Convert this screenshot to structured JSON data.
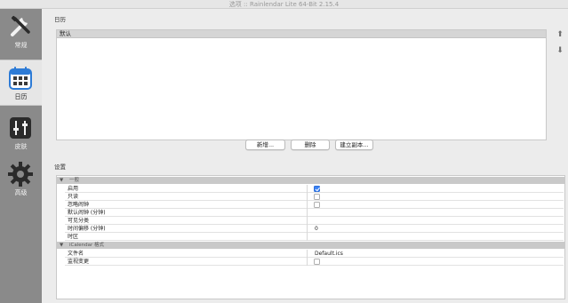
{
  "window": {
    "title": "选项 :: Rainlendar Lite 64-Bit 2.15.4"
  },
  "sidebar": {
    "items": [
      {
        "label": "常规",
        "icon": "tools-icon",
        "active": false
      },
      {
        "label": "日历",
        "icon": "calendar-icon",
        "active": true
      },
      {
        "label": "皮肤",
        "icon": "sliders-icon",
        "active": false
      },
      {
        "label": "高级",
        "icon": "gear-icon",
        "active": false
      }
    ]
  },
  "calendars": {
    "section_label": "日历",
    "list_header": "默认",
    "move_up_icon": "arrow-up-icon",
    "move_down_icon": "arrow-down-icon",
    "buttons": {
      "new": "新增...",
      "delete": "删除",
      "duplicate": "建立副本..."
    }
  },
  "settings": {
    "section_label": "设置",
    "groups": [
      {
        "label": "一般",
        "rows": [
          {
            "name": "启用",
            "type": "checkbox",
            "checked": true
          },
          {
            "name": "只读",
            "type": "checkbox",
            "checked": false
          },
          {
            "name": "忽略闹钟",
            "type": "checkbox",
            "checked": false
          },
          {
            "name": "默认闹钟 (分钟)",
            "type": "text",
            "value": ""
          },
          {
            "name": "可见分类",
            "type": "text",
            "value": ""
          },
          {
            "name": "时间偏移 (分钟)",
            "type": "text",
            "value": "0"
          },
          {
            "name": "时区",
            "type": "text",
            "value": ""
          }
        ]
      },
      {
        "label": "iCalendar 格式",
        "rows": [
          {
            "name": "文件名",
            "type": "text",
            "value": "Default.ics"
          },
          {
            "name": "监视变更",
            "type": "checkbox",
            "checked": false
          }
        ]
      }
    ]
  },
  "colors": {
    "accent": "#3b82f6",
    "sidebar": "#8a8a8a"
  }
}
